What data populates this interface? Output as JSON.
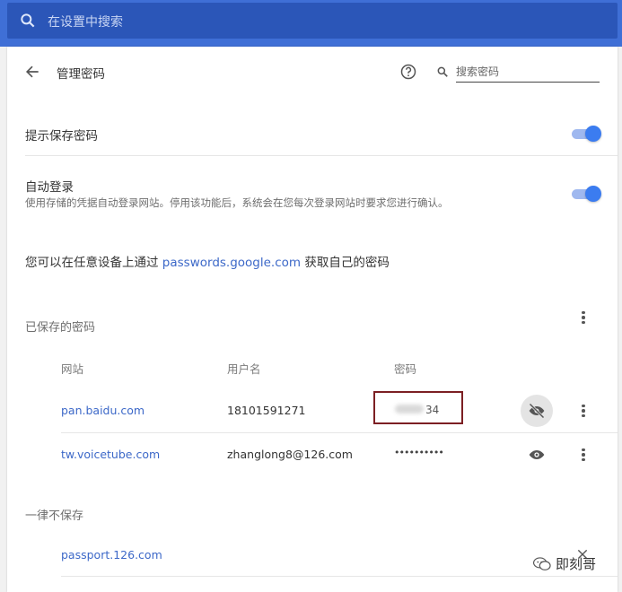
{
  "search": {
    "placeholder": "在设置中搜索"
  },
  "header": {
    "title": "管理密码",
    "search_placeholder": "搜索密码"
  },
  "settings": {
    "offer_to_save": "提示保存密码",
    "auto_signin_title": "自动登录",
    "auto_signin_desc": "使用存储的凭据自动登录网站。停用该功能后，系统会在您每次登录网站时要求您进行确认。",
    "info_prefix": "您可以在任意设备上通过 ",
    "info_link": "passwords.google.com",
    "info_suffix": " 获取自己的密码"
  },
  "saved": {
    "heading": "已保存的密码",
    "columns": {
      "site": "网站",
      "username": "用户名",
      "password": "密码"
    },
    "rows": [
      {
        "site": "pan.baidu.com",
        "username": "18101591271",
        "password": "34"
      },
      {
        "site": "tw.voicetube.com",
        "username": "zhanglong8@126.com",
        "password": "••••••••••"
      }
    ]
  },
  "never": {
    "heading": "一律不保存",
    "rows": [
      {
        "site": "passport.126.com"
      }
    ]
  },
  "watermark": {
    "text": "即刻哥"
  },
  "colors": {
    "accent": "#3b7cf0",
    "header_bg": "#3f6fd6",
    "link": "#3c68c8",
    "highlight": "#7c1f23"
  },
  "icons": [
    "search-icon",
    "back-arrow-icon",
    "help-icon",
    "eye-off-icon",
    "eye-icon",
    "more-vert-icon",
    "close-icon",
    "wechat-icon"
  ]
}
